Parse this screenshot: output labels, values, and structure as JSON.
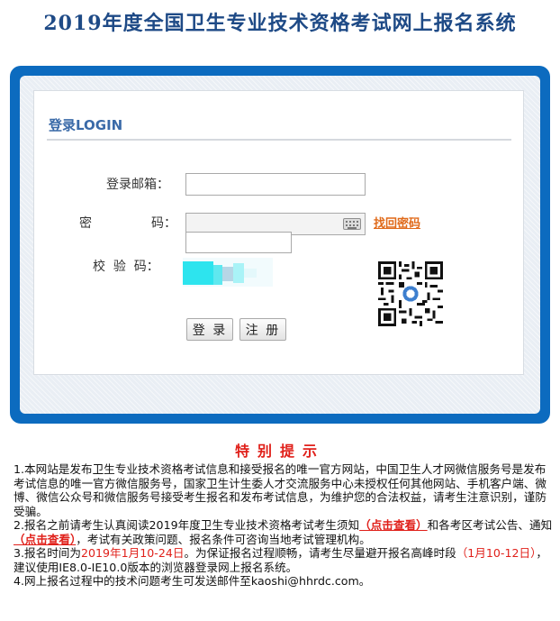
{
  "header": {
    "title": "2019年度全国卫生专业技术资格考试网上报名系统"
  },
  "login": {
    "heading": "登录LOGIN",
    "email_label": "登录邮箱：",
    "password_label_1": "密",
    "password_label_2": "码：",
    "captcha_label": "校  验  码：",
    "email_value": "",
    "password_value": "",
    "forgot_link": "找回密码",
    "login_button": "登 录",
    "register_button": "注 册"
  },
  "notice": {
    "title": "特别提示",
    "item1": "1.本网站是发布卫生专业技术资格考试信息和接受报名的唯一官方网站，中国卫生人才网微信服务号是发布考试信息的唯一官方微信服务号，国家卫生计生委人才交流服务中心未授权任何其他网站、手机客户端、微博、微信公众号和微信服务号接受考生报名和发布考试信息，为维护您的合法权益，请考生注意识别，谨防受骗。",
    "item2_a": "2.报名之前请考生认真阅读2019年度卫生专业技术资格考试考生须知",
    "item2_link1": "（点击查看）",
    "item2_b": "和各考区考试公告、通知",
    "item2_link2": "（点击查看）",
    "item2_c": "，考试有关政策问题、报名条件可咨询当地考试管理机构。",
    "item3_a": "3.报名时间为",
    "item3_dates": "2019年1月10-24日",
    "item3_b": "。为保证报名过程顺畅，请考生尽量避开报名高峰时段",
    "item3_peak": "（1月10-12日）",
    "item3_c": "，建议使用IE8.0-IE10.0版本的浏览器登录网上报名系统。",
    "item4": "4.网上报名过程中的技术问题考生可发送邮件至kaoshi@hhrdc.com。"
  },
  "colors": {
    "title_blue": "#1e4a86",
    "frame_blue": "#0c6bbf",
    "link_orange": "#e06a1a",
    "notice_red": "#e0201a"
  }
}
